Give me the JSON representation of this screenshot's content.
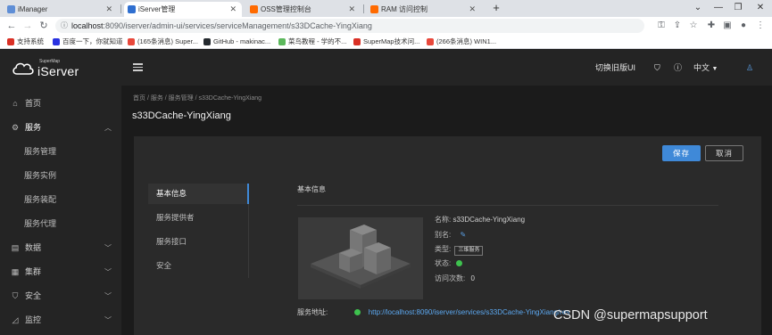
{
  "browser": {
    "tabs": [
      {
        "title": "iManager",
        "color": "#5f8ed6",
        "active": false
      },
      {
        "title": "iServer管理",
        "color": "#2f6fd0",
        "active": true
      },
      {
        "title": "OSS管理控制台",
        "color": "#ff6a00",
        "active": false
      },
      {
        "title": "RAM 访问控制",
        "color": "#ff6a00",
        "active": false
      }
    ],
    "new_tab": "+",
    "url_host": "localhost",
    "url_path": ":8090/iserver/admin-ui/services/serviceManagement/s33DCache-YingXiang",
    "bookmarks": [
      {
        "label": "支持系统",
        "color": "#d93025"
      },
      {
        "label": "百度一下，你就知道",
        "color": "#2932e1"
      },
      {
        "label": "(165条消息) Super...",
        "color": "#e8483b"
      },
      {
        "label": "GitHub - makinac...",
        "color": "#24292e"
      },
      {
        "label": "菜鸟教程 - 学的不...",
        "color": "#5cb85c"
      },
      {
        "label": "SuperMap技术问...",
        "color": "#d93025"
      },
      {
        "label": "(266条消息) WIN1...",
        "color": "#e8483b"
      }
    ]
  },
  "app": {
    "logo_small": "SuperMap",
    "logo_text": "iServer",
    "switch_ui": "切换旧版UI",
    "language": "中文"
  },
  "sidebar": {
    "items": [
      {
        "label": "首页",
        "icon": "home-icon",
        "glyph": "⌂"
      },
      {
        "label": "服务",
        "icon": "services-icon",
        "glyph": "⚙"
      },
      {
        "label": "服务管理"
      },
      {
        "label": "服务实例"
      },
      {
        "label": "服务装配"
      },
      {
        "label": "服务代理"
      },
      {
        "label": "数据",
        "icon": "data-icon",
        "glyph": "▤"
      },
      {
        "label": "集群",
        "icon": "cluster-icon",
        "glyph": "▦"
      },
      {
        "label": "安全",
        "icon": "security-icon",
        "glyph": "⛉"
      },
      {
        "label": "监控",
        "icon": "monitor-icon",
        "glyph": "◿"
      }
    ]
  },
  "main": {
    "breadcrumb": "首页  /  服务  /  服务管理  /  s33DCache-YingXiang",
    "title": "s33DCache-YingXiang",
    "save_label": "保存",
    "cancel_label": "取消",
    "vtabs": [
      "基本信息",
      "服务提供者",
      "服务接口",
      "安全"
    ],
    "section_title": "基本信息",
    "name_label": "名称:",
    "name_value": "s33DCache-YingXiang",
    "alias_label": "别名:",
    "type_label": "类型:",
    "type_value": "三维服务",
    "status_label": "状态:",
    "visits_label": "访问次数:",
    "visits_value": "0",
    "address_label": "服务地址:",
    "address_value": "http://localhost:8090/iserver/services/s33DCache-YingXiang/res"
  },
  "watermark": "CSDN @supermapsupport"
}
